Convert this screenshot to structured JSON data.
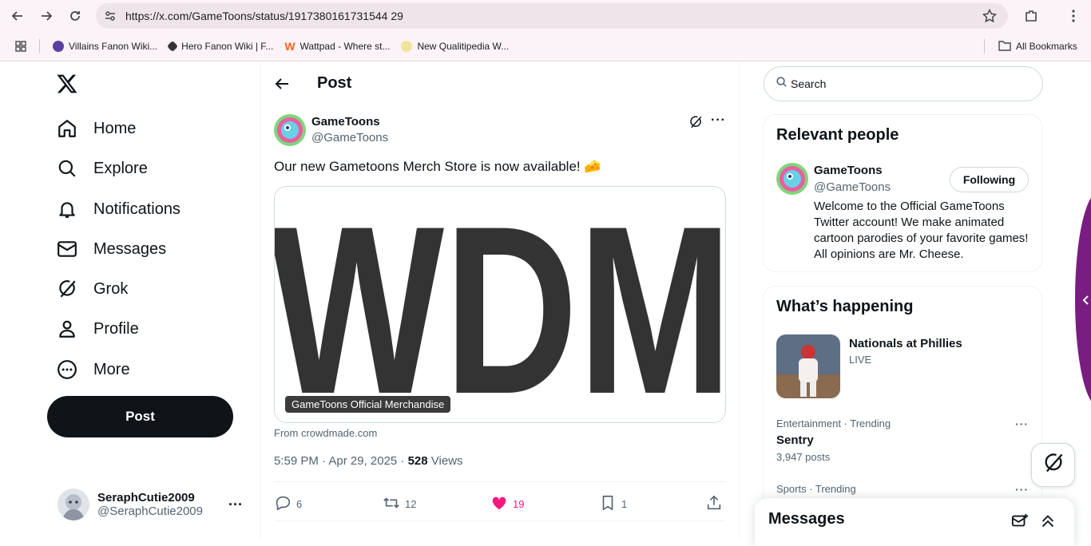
{
  "browser": {
    "url": "https://x.com/GameToons/status/1917380161731544 29",
    "bookmarks": [
      {
        "label": "Villains Fanon Wiki...",
        "color": "#5b3fa0"
      },
      {
        "label": "Hero Fanon Wiki | F...",
        "color": "#333333"
      },
      {
        "label": "Wattpad - Where st...",
        "color": "#ff6122"
      },
      {
        "label": "New Qualitipedia W...",
        "color": "#d8b000"
      }
    ],
    "all_bookmarks": "All Bookmarks"
  },
  "nav": {
    "items": [
      {
        "label": "Home",
        "icon": "home-icon"
      },
      {
        "label": "Explore",
        "icon": "search-icon"
      },
      {
        "label": "Notifications",
        "icon": "bell-icon"
      },
      {
        "label": "Messages",
        "icon": "mail-icon"
      },
      {
        "label": "Grok",
        "icon": "grok-icon"
      },
      {
        "label": "Profile",
        "icon": "person-icon"
      },
      {
        "label": "More",
        "icon": "more-circle-icon"
      }
    ],
    "post_label": "Post",
    "account": {
      "name": "SeraphCutie2009",
      "handle": "@SeraphCutie2009"
    }
  },
  "main": {
    "title": "Post",
    "tweet": {
      "name": "GameToons",
      "handle": "@GameToons",
      "text": "Our new Gametoons Merch Store is now available! 🧀",
      "card_label": "GameToons Official Merchandise",
      "card_image_text": "WDM",
      "from": "From crowdmade.com",
      "time": "5:59 PM · Apr 29, 2025 · ",
      "views_count": "528",
      "views_label": " Views",
      "replies": "6",
      "reposts": "12",
      "likes": "19",
      "bookmarks": "1",
      "like_color": "#f91880"
    }
  },
  "right": {
    "search_placeholder": "Search",
    "relevant": {
      "title": "Relevant people",
      "name": "GameToons",
      "handle": "@GameToons",
      "follow_label": "Following",
      "bio": "Welcome to the Official GameToons Twitter account! We make animated cartoon parodies of your favorite games! All opinions are Mr. Cheese."
    },
    "happening": {
      "title": "What’s happening",
      "featured": {
        "title": "Nationals at Phillies",
        "status": "LIVE"
      },
      "trends": [
        {
          "category": "Entertainment · Trending",
          "name": "Sentry",
          "count": "3,947 posts"
        },
        {
          "category": "Sports · Trending",
          "name": "",
          "count": ""
        }
      ]
    },
    "messages_title": "Messages"
  }
}
